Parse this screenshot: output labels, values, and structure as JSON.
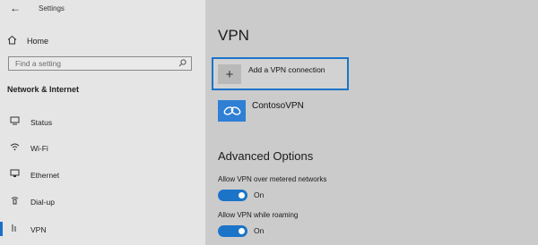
{
  "window": {
    "back_glyph": "←",
    "title": "Settings"
  },
  "sidebar": {
    "home_label": "Home",
    "search_placeholder": "Find a setting",
    "section_title": "Network & Internet",
    "items": [
      {
        "label": "Status",
        "icon": "status-icon"
      },
      {
        "label": "Wi-Fi",
        "icon": "wifi-icon"
      },
      {
        "label": "Ethernet",
        "icon": "ethernet-icon"
      },
      {
        "label": "Dial-up",
        "icon": "dialup-icon"
      },
      {
        "label": "VPN",
        "icon": "vpn-icon",
        "selected": true
      }
    ]
  },
  "main": {
    "title": "VPN",
    "add_label": "Add a VPN connection",
    "add_glyph": "+",
    "connection_name": "ContosoVPN",
    "advanced_title": "Advanced Options",
    "options": [
      {
        "label": "Allow VPN over metered networks",
        "state": "On",
        "enabled": true
      },
      {
        "label": "Allow VPN while roaming",
        "state": "On",
        "enabled": true
      }
    ]
  },
  "colors": {
    "accent": "#1b74c8",
    "sidebar_bg": "#e5e5e5",
    "main_bg": "#cbcbcb"
  }
}
